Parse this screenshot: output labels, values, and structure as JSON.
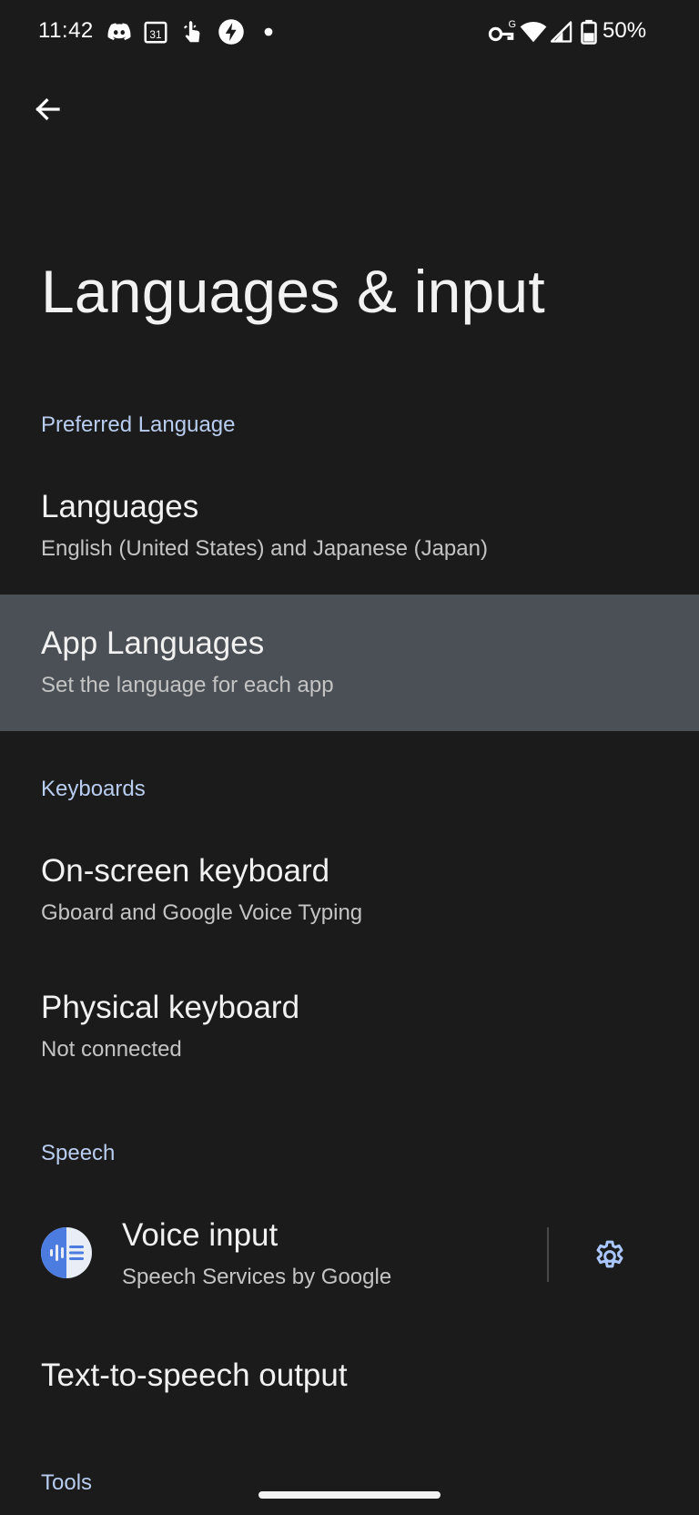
{
  "status_bar": {
    "time": "11:42",
    "notification_icons": [
      "discord-icon",
      "calendar-icon",
      "touch-gesture-icon",
      "bolt-icon",
      "dot-icon"
    ],
    "calendar_day": "31",
    "system_icons": [
      "vpn-key-icon",
      "wifi-icon",
      "cellular-signal-icon",
      "battery-icon"
    ],
    "vpn_badge": "G",
    "battery": "50%"
  },
  "header": {
    "back_icon": "arrow-back-icon",
    "title": "Languages & input"
  },
  "sections": {
    "preferred_language": "Preferred Language",
    "keyboards": "Keyboards",
    "speech": "Speech",
    "tools": "Tools"
  },
  "items": {
    "languages": {
      "title": "Languages",
      "summary": "English (United States) and Japanese (Japan)"
    },
    "app_languages": {
      "title": "App Languages",
      "summary": "Set the language for each app"
    },
    "on_screen_keyboard": {
      "title": "On-screen keyboard",
      "summary": "Gboard and Google Voice Typing"
    },
    "physical_keyboard": {
      "title": "Physical keyboard",
      "summary": "Not connected"
    },
    "voice_input": {
      "title": "Voice input",
      "summary": "Speech Services by Google",
      "icon": "speech-services-icon",
      "settings_icon": "gear-icon"
    },
    "text_to_speech": {
      "title": "Text-to-speech output"
    }
  },
  "colors": {
    "background": "#1b1b1b",
    "highlight": "#4b5057",
    "section_header": "#b9cdf0",
    "accent": "#aac7ff"
  }
}
